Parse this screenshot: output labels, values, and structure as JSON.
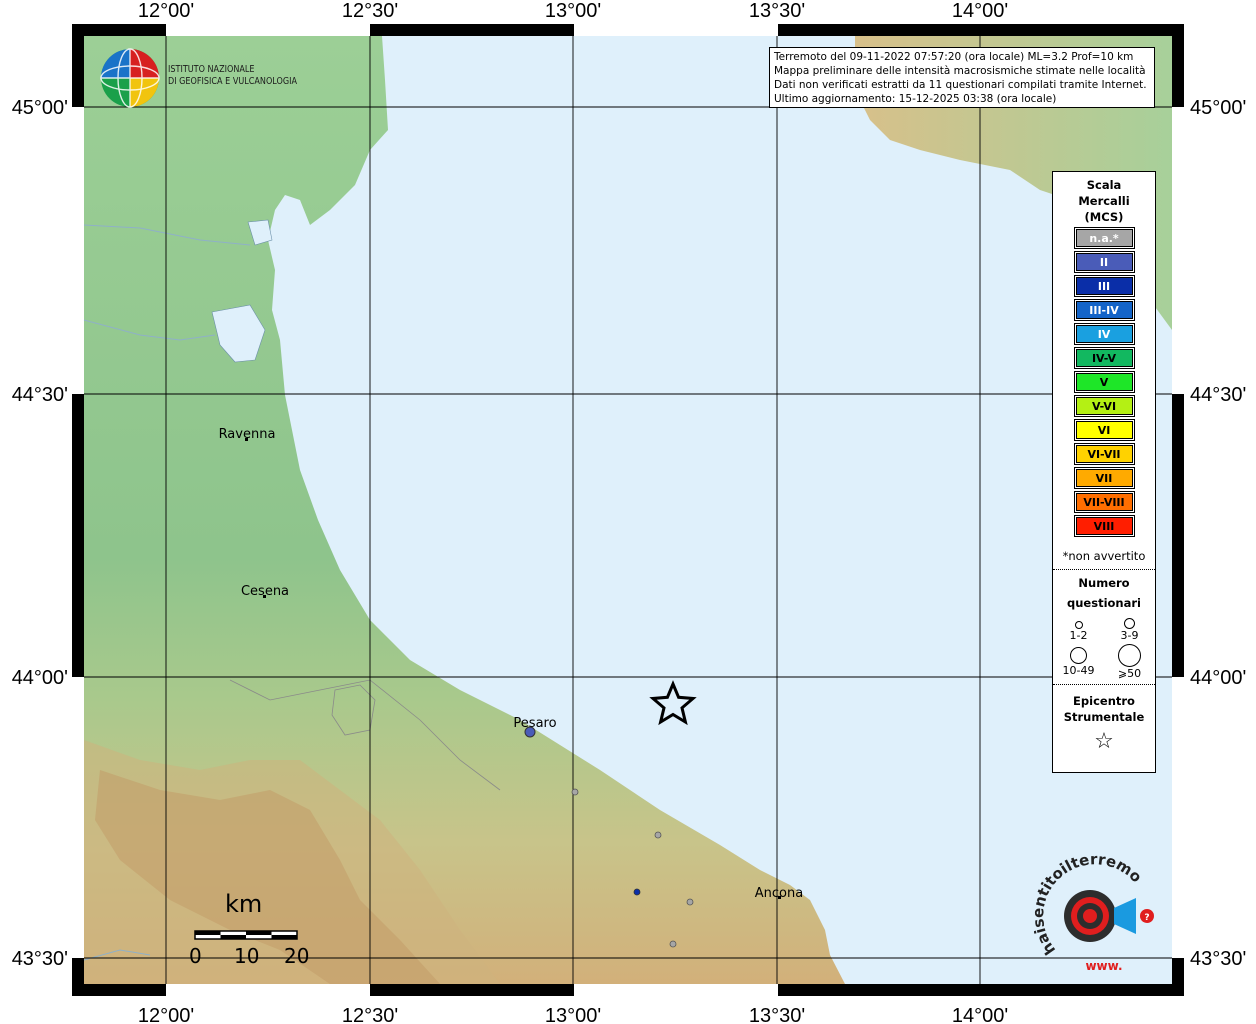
{
  "header": {
    "info_lines": [
      "Terremoto del 09-11-2022 07:57:20 (ora locale) ML=3.2 Prof=10 km",
      "Mappa preliminare delle intensità macrosismiche stimate nelle località",
      "Dati non verificati estratti da 11 questionari compilati tramite Internet.",
      "Ultimo aggiornamento: 15-12-2025 03:38 (ora locale)"
    ]
  },
  "logo_ingv": {
    "line1": "ISTITUTO NAZIONALE",
    "line2": "DI GEOFISICA E VULCANOLOGIA"
  },
  "logo_hst": {
    "text": "haisentitoilterremoto.it",
    "www": "www."
  },
  "axes": {
    "lon_ticks": [
      "12°00'",
      "12°30'",
      "13°00'",
      "13°30'",
      "14°00'"
    ],
    "lat_ticks": [
      "45°00'",
      "44°30'",
      "44°00'",
      "43°30'"
    ]
  },
  "cities": [
    {
      "name": "Ravenna"
    },
    {
      "name": "Cesena"
    },
    {
      "name": "Pesaro"
    },
    {
      "name": "Ancona"
    }
  ],
  "legend": {
    "title_line1": "Scala",
    "title_line2": "Mercalli",
    "title_line3": "(MCS)",
    "mcs": [
      {
        "label": "n.a.*",
        "color": "#a6a6a6",
        "text_color": "#ffffff"
      },
      {
        "label": "II",
        "color": "#4a5cb8",
        "text_color": "#ffffff"
      },
      {
        "label": "III",
        "color": "#0a2ea8",
        "text_color": "#ffffff"
      },
      {
        "label": "III-IV",
        "color": "#1464c8",
        "text_color": "#ffffff"
      },
      {
        "label": "IV",
        "color": "#1aa0e0",
        "text_color": "#ffffff"
      },
      {
        "label": "IV-V",
        "color": "#12b860",
        "text_color": "#000000"
      },
      {
        "label": "V",
        "color": "#1ee628",
        "text_color": "#000000"
      },
      {
        "label": "V-VI",
        "color": "#b4f014",
        "text_color": "#000000"
      },
      {
        "label": "VI",
        "color": "#ffff00",
        "text_color": "#000000"
      },
      {
        "label": "VI-VII",
        "color": "#ffd200",
        "text_color": "#000000"
      },
      {
        "label": "VII",
        "color": "#ffaa00",
        "text_color": "#000000"
      },
      {
        "label": "VII-VIII",
        "color": "#ff6e00",
        "text_color": "#000000"
      },
      {
        "label": "VIII",
        "color": "#ff1e00",
        "text_color": "#000000"
      }
    ],
    "note": "*non avvertito",
    "questionnaires_title1": "Numero",
    "questionnaires_title2": "questionari",
    "sizes": [
      "1-2",
      "3-9",
      "10-49",
      "⩾50"
    ],
    "epicenter_title1": "Epicentro",
    "epicenter_title2": "Strumentale",
    "epicenter_symbol": "☆"
  },
  "scale_bar": {
    "unit": "km",
    "labels": [
      "0",
      "10",
      "20"
    ]
  },
  "colors": {
    "sea": "#dff0fb",
    "land_low": "#9fc99a",
    "land_high": "#c9a070",
    "grid": "#000000"
  }
}
